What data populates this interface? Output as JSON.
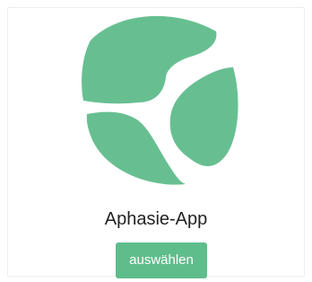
{
  "app": {
    "name": "Aphasie-App",
    "logo_icon": "aphasia-app-logo-icon"
  },
  "actions": {
    "select_label": "auswählen"
  },
  "colors": {
    "accent": "#5fbd8c",
    "logo": "#67bf91"
  }
}
